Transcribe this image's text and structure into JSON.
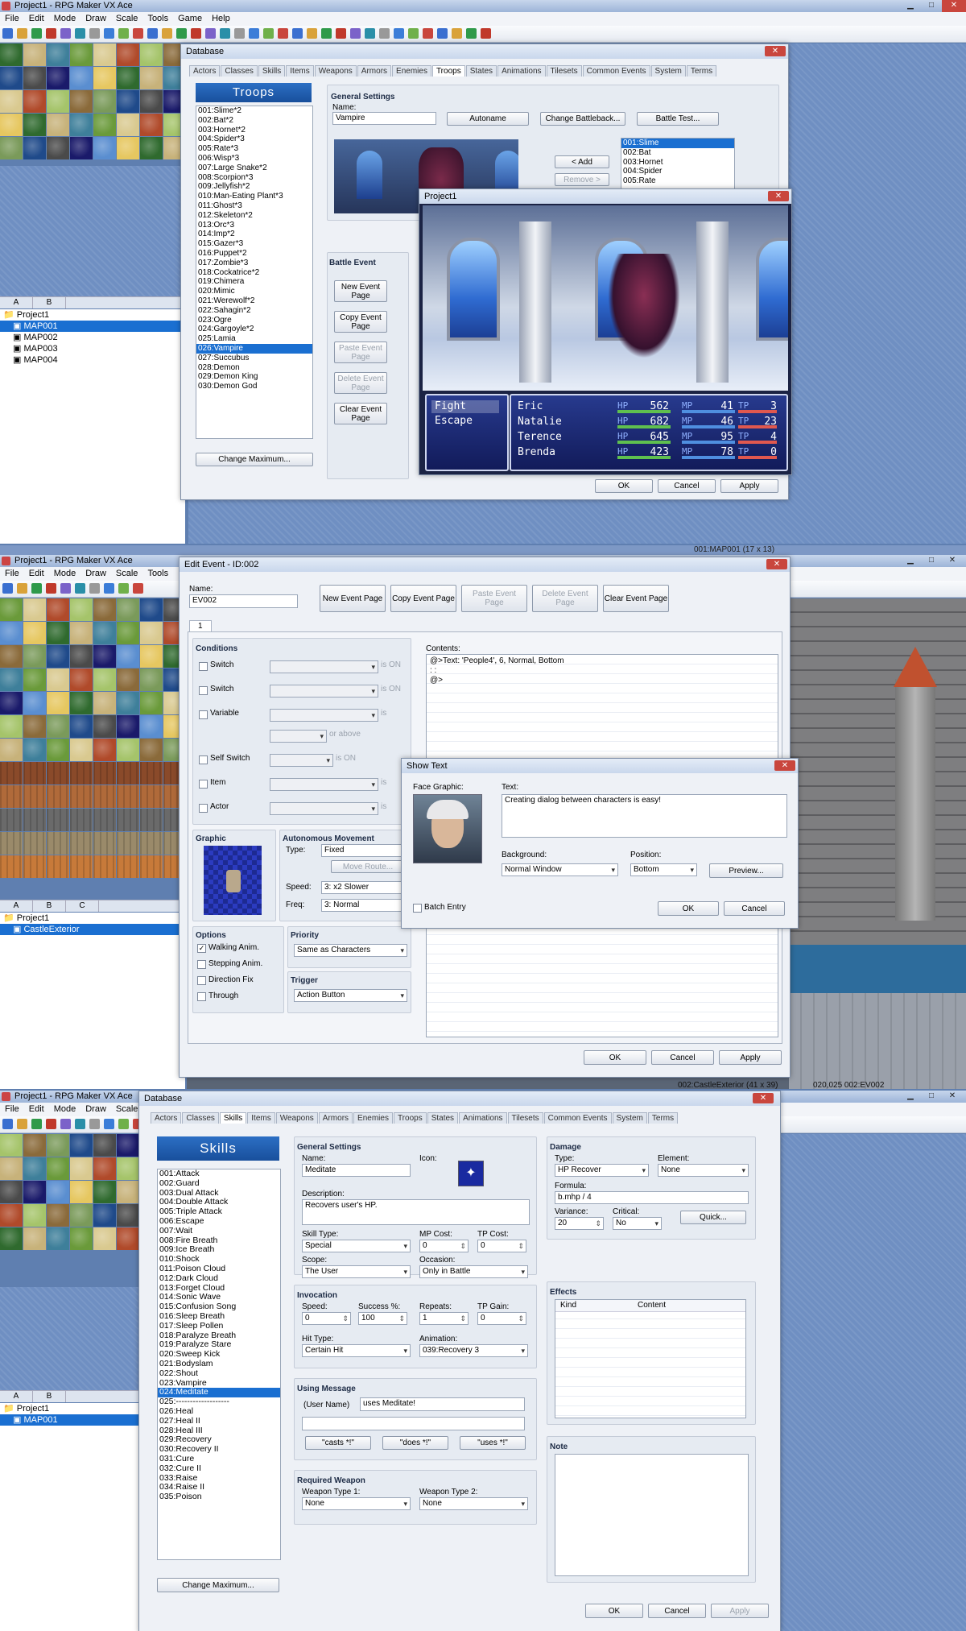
{
  "p1": {
    "app_title": "Project1 - RPG Maker VX Ace",
    "menu": [
      "File",
      "Edit",
      "Mode",
      "Draw",
      "Scale",
      "Tools",
      "Game",
      "Help"
    ],
    "tree_tabs": [
      "A",
      "B"
    ],
    "tree": {
      "root": "Project1",
      "maps": [
        "MAP001",
        "MAP002",
        "MAP003",
        "MAP004"
      ]
    },
    "db_title": "Database",
    "tabs": [
      "Actors",
      "Classes",
      "Skills",
      "Items",
      "Weapons",
      "Armors",
      "Enemies",
      "Troops",
      "States",
      "Animations",
      "Tilesets",
      "Common Events",
      "System",
      "Terms"
    ],
    "list_header": "Troops",
    "troops": [
      "001:Slime*2",
      "002:Bat*2",
      "003:Hornet*2",
      "004:Spider*3",
      "005:Rate*3",
      "006:Wisp*3",
      "007:Large Snake*2",
      "008:Scorpion*3",
      "009:Jellyfish*2",
      "010:Man-Eating Plant*3",
      "011:Ghost*3",
      "012:Skeleton*2",
      "013:Orc*3",
      "014:Imp*2",
      "015:Gazer*3",
      "016:Puppet*2",
      "017:Zombie*3",
      "018:Cockatrice*2",
      "019:Chimera",
      "020:Mimic",
      "021:Werewolf*2",
      "022:Sahagin*2",
      "023:Ogre",
      "024:Gargoyle*2",
      "025:Lamia",
      "026:Vampire",
      "027:Succubus",
      "028:Demon",
      "029:Demon King",
      "030:Demon God"
    ],
    "change_max": "Change Maximum...",
    "general_settings": "General Settings",
    "name_label": "Name:",
    "name_value": "Vampire",
    "autoname": "Autoname",
    "change_battleback": "Change Battleback...",
    "battle_test": "Battle Test...",
    "add": "< Add",
    "remove": "Remove >",
    "enemies": [
      "001:Slime",
      "002:Bat",
      "003:Hornet",
      "004:Spider",
      "005:Rate"
    ],
    "battle_event": "Battle Event",
    "btn_new": "New Event Page",
    "btn_copy": "Copy Event Page",
    "btn_paste": "Paste Event Page",
    "btn_delete": "Delete Event Page",
    "btn_clear": "Clear Event Page",
    "ok": "OK",
    "cancel": "Cancel",
    "apply": "Apply",
    "game_title": "Project1",
    "commands": [
      "Fight",
      "Escape"
    ],
    "party": [
      {
        "name": "Eric",
        "hp": "562",
        "mp": "41",
        "tp": "3"
      },
      {
        "name": "Natalie",
        "hp": "682",
        "mp": "46",
        "tp": "23"
      },
      {
        "name": "Terence",
        "hp": "645",
        "mp": "95",
        "tp": "4"
      },
      {
        "name": "Brenda",
        "hp": "423",
        "mp": "78",
        "tp": "0"
      }
    ],
    "hp_label": "HP",
    "mp_label": "MP",
    "tp_label": "TP"
  },
  "p2": {
    "app_title": "Project1 - RPG Maker VX Ace",
    "menu": [
      "File",
      "Edit",
      "Mode",
      "Draw",
      "Scale",
      "Tools"
    ],
    "status": "001:MAP001 (17 x 13)",
    "tree_tabs": [
      "A",
      "B",
      "C"
    ],
    "tree": {
      "root": "Project1",
      "maps": [
        "CastleExterior"
      ]
    },
    "dlg_title": "Edit Event - ID:002",
    "name_label": "Name:",
    "name_value": "EV002",
    "btn_new": "New Event Page",
    "btn_copy": "Copy Event Page",
    "btn_paste": "Paste Event Page",
    "btn_delete": "Delete Event Page",
    "btn_clear": "Clear Event Page",
    "page_tab": "1",
    "conditions": "Conditions",
    "cond_switch": "Switch",
    "cond_switch2": "Switch",
    "cond_variable": "Variable",
    "cond_self": "Self Switch",
    "cond_item": "Item",
    "cond_actor": "Actor",
    "is_on": "is ON",
    "is": "is",
    "or_above": "or above",
    "contents": "Contents:",
    "content_line1": "@>Text: 'People4', 6, Normal, Bottom",
    "content_line2": ":        :",
    "content_line3": "@>",
    "graphic": "Graphic",
    "auto_move": "Autonomous Movement",
    "type_label": "Type:",
    "type_value": "Fixed",
    "move_route": "Move Route...",
    "speed_label": "Speed:",
    "speed_value": "3: x2 Slower",
    "freq_label": "Freq:",
    "freq_value": "3: Normal",
    "options": "Options",
    "opt_walk": "Walking Anim.",
    "opt_step": "Stepping Anim.",
    "opt_dir": "Direction Fix",
    "opt_through": "Through",
    "priority": "Priority",
    "priority_value": "Same as Characters",
    "trigger": "Trigger",
    "trigger_value": "Action Button",
    "ok": "OK",
    "cancel": "Cancel",
    "apply": "Apply",
    "st_title": "Show Text",
    "face_graphic": "Face Graphic:",
    "text_label": "Text:",
    "text_value": "Creating dialog between characters is easy!",
    "background": "Background:",
    "background_value": "Normal Window",
    "position": "Position:",
    "position_value": "Bottom",
    "preview": "Preview...",
    "batch": "Batch Entry",
    "st_ok": "OK",
    "st_cancel": "Cancel",
    "status_bottom": "002:CastleExterior (41 x 39)",
    "coords": "020,025  002:EV002"
  },
  "p3": {
    "app_title": "Project1 - RPG Maker VX Ace",
    "menu": [
      "File",
      "Edit",
      "Mode",
      "Draw",
      "Scale"
    ],
    "tree_tabs": [
      "A",
      "B"
    ],
    "tree": {
      "root": "Project1",
      "maps": [
        "MAP001"
      ]
    },
    "db_title": "Database",
    "tabs": [
      "Actors",
      "Classes",
      "Skills",
      "Items",
      "Weapons",
      "Armors",
      "Enemies",
      "Troops",
      "States",
      "Animations",
      "Tilesets",
      "Common Events",
      "System",
      "Terms"
    ],
    "list_header": "Skills",
    "skills": [
      "001:Attack",
      "002:Guard",
      "003:Dual Attack",
      "004:Double Attack",
      "005:Triple Attack",
      "006:Escape",
      "007:Wait",
      "008:Fire Breath",
      "009:Ice Breath",
      "010:Shock",
      "011:Poison Cloud",
      "012:Dark Cloud",
      "013:Forget Cloud",
      "014:Sonic Wave",
      "015:Confusion Song",
      "016:Sleep Breath",
      "017:Sleep Pollen",
      "018:Paralyze Breath",
      "019:Paralyze Stare",
      "020:Sweep Kick",
      "021:Bodyslam",
      "022:Shout",
      "023:Vampire",
      "024:Meditate",
      "025:-------------------",
      "026:Heal",
      "027:Heal II",
      "028:Heal III",
      "029:Recovery",
      "030:Recovery II",
      "031:Cure",
      "032:Cure II",
      "033:Raise",
      "034:Raise II",
      "035:Poison"
    ],
    "change_max": "Change Maximum...",
    "general_settings": "General Settings",
    "name_label": "Name:",
    "name_value": "Meditate",
    "icon_label": "Icon:",
    "desc_label": "Description:",
    "desc_value": "Recovers user's HP.",
    "skill_type_label": "Skill Type:",
    "skill_type_value": "Special",
    "mp_cost_label": "MP Cost:",
    "mp_cost_value": "0",
    "tp_cost_label": "TP Cost:",
    "tp_cost_value": "0",
    "scope_label": "Scope:",
    "scope_value": "The User",
    "occasion_label": "Occasion:",
    "occasion_value": "Only in Battle",
    "invocation": "Invocation",
    "speed_label": "Speed:",
    "speed_value": "0",
    "success_label": "Success %:",
    "success_value": "100",
    "repeats_label": "Repeats:",
    "repeats_value": "1",
    "tp_gain_label": "TP Gain:",
    "tp_gain_value": "0",
    "hit_type_label": "Hit Type:",
    "hit_type_value": "Certain Hit",
    "animation_label": "Animation:",
    "animation_value": "039:Recovery 3",
    "using_message": "Using Message",
    "user_name": "(User Name)",
    "message_value": "uses Meditate!",
    "casts": "\"casts *!\"",
    "does": "\"does *!\"",
    "uses": "\"uses *!\"",
    "required_weapon": "Required Weapon",
    "wt1_label": "Weapon Type 1:",
    "wt1_value": "None",
    "wt2_label": "Weapon Type 2:",
    "wt2_value": "None",
    "damage": "Damage",
    "dmg_type_label": "Type:",
    "dmg_type_value": "HP Recover",
    "element_label": "Element:",
    "element_value": "None",
    "formula_label": "Formula:",
    "formula_value": "b.mhp / 4",
    "variance_label": "Variance:",
    "variance_value": "20",
    "critical_label": "Critical:",
    "critical_value": "No",
    "quick": "Quick...",
    "effects": "Effects",
    "kind": "Kind",
    "content": "Content",
    "note": "Note",
    "ok": "OK",
    "cancel": "Cancel",
    "apply": "Apply"
  }
}
